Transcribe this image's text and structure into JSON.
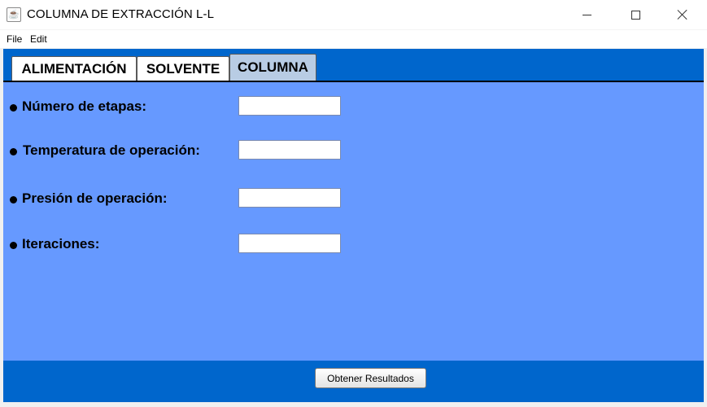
{
  "window": {
    "title": "COLUMNA DE EXTRACCIÓN L-L",
    "app_icon": "java-cup-icon"
  },
  "menu": {
    "items": [
      {
        "label": "File"
      },
      {
        "label": "Edit"
      }
    ]
  },
  "tabs": [
    {
      "label": "ALIMENTACIÓN",
      "selected": false
    },
    {
      "label": "SOLVENTE",
      "selected": false
    },
    {
      "label": "COLUMNA",
      "selected": true
    }
  ],
  "form": {
    "fields": [
      {
        "label": "Número de etapas:",
        "value": ""
      },
      {
        "label": "Temperatura de operación:",
        "value": ""
      },
      {
        "label": "Presión de operación:",
        "value": ""
      },
      {
        "label": "Iteraciones:",
        "value": ""
      }
    ]
  },
  "actions": {
    "submit_label": "Obtener Resultados"
  },
  "colors": {
    "frame_blue": "#0066cc",
    "content_blue": "#6699ff",
    "selected_tab": "#b8cce4"
  }
}
